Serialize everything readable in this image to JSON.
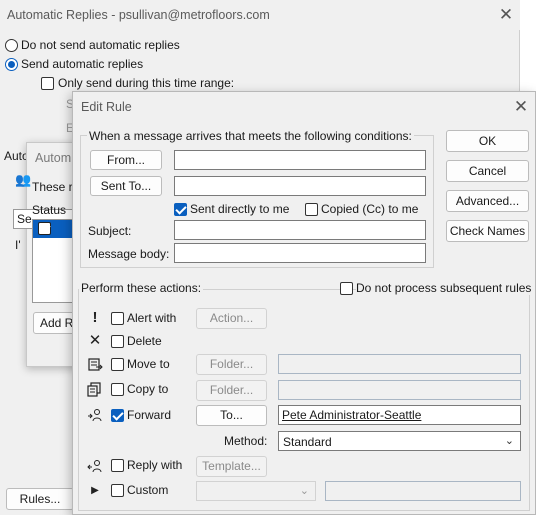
{
  "auto_replies": {
    "title": "Automatic Replies - psullivan@metrofloors.com",
    "radio_off_label": "Do not send automatic replies",
    "radio_on_label": "Send automatic replies",
    "time_range_label": "Only send during this time range:",
    "partial_s": "S",
    "partial_e": "E",
    "partial_auto": "Auto",
    "rules_button": "Rules..."
  },
  "auto_mid": {
    "title": "Autom",
    "these_rules": "These ru",
    "select_partial": "Se",
    "status_header": "Status",
    "text_partial": "I'",
    "add_rule_partial": "Add R"
  },
  "edit_rule": {
    "title": "Edit Rule",
    "conditions_header": "When a message arrives that meets the following conditions:",
    "from_button": "From...",
    "from_value": "",
    "sent_to_button": "Sent To...",
    "sent_to_value": "",
    "sent_directly_label": "Sent directly to me",
    "copied_label": "Copied (Cc) to me",
    "subject_label": "Subject:",
    "subject_value": "",
    "body_label": "Message body:",
    "body_value": "",
    "ok_button": "OK",
    "cancel_button": "Cancel",
    "advanced_button": "Advanced...",
    "check_names_button": "Check Names",
    "perform_header": "Perform these actions:",
    "do_not_process_label": "Do not process subsequent rules",
    "actions": {
      "alert_label": "Alert with",
      "alert_button": "Action...",
      "delete_label": "Delete",
      "move_label": "Move to",
      "move_button": "Folder...",
      "copy_label": "Copy to",
      "copy_button": "Folder...",
      "forward_label": "Forward",
      "forward_button": "To...",
      "forward_value": "Pete Administrator-Seattle",
      "method_label": "Method:",
      "method_value": "Standard",
      "reply_label": "Reply with",
      "reply_button": "Template...",
      "custom_label": "Custom",
      "custom_value": ""
    }
  },
  "colors": {
    "accent": "#0a5fbf",
    "dialog_bg": "#f0f0f0"
  }
}
